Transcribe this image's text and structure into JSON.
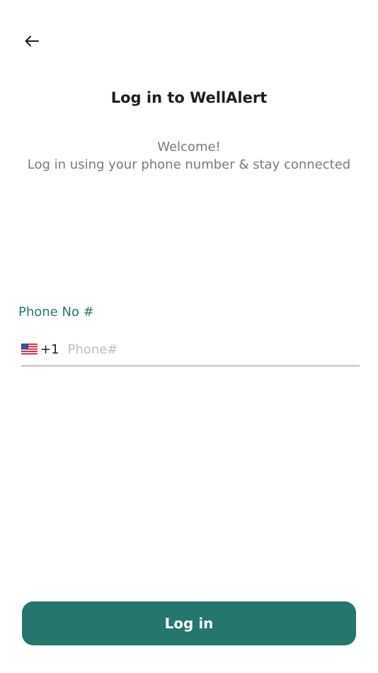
{
  "header": {
    "back_icon": "arrow-left-icon"
  },
  "title": {
    "highlight": "Log in",
    "rest": " to WellAlert"
  },
  "subtitle": {
    "line1": "Welcome!",
    "line2": "Log in using your phone number & stay connected"
  },
  "phone_field": {
    "label": "Phone No #",
    "country_flag_icon": "us-flag-icon",
    "country_code": "+1",
    "value": "",
    "placeholder": "Phone#"
  },
  "login_button": {
    "label": "Log in"
  },
  "colors": {
    "accent": "#25766c",
    "label": "#24786d",
    "highlight": "#8fc7bb"
  }
}
